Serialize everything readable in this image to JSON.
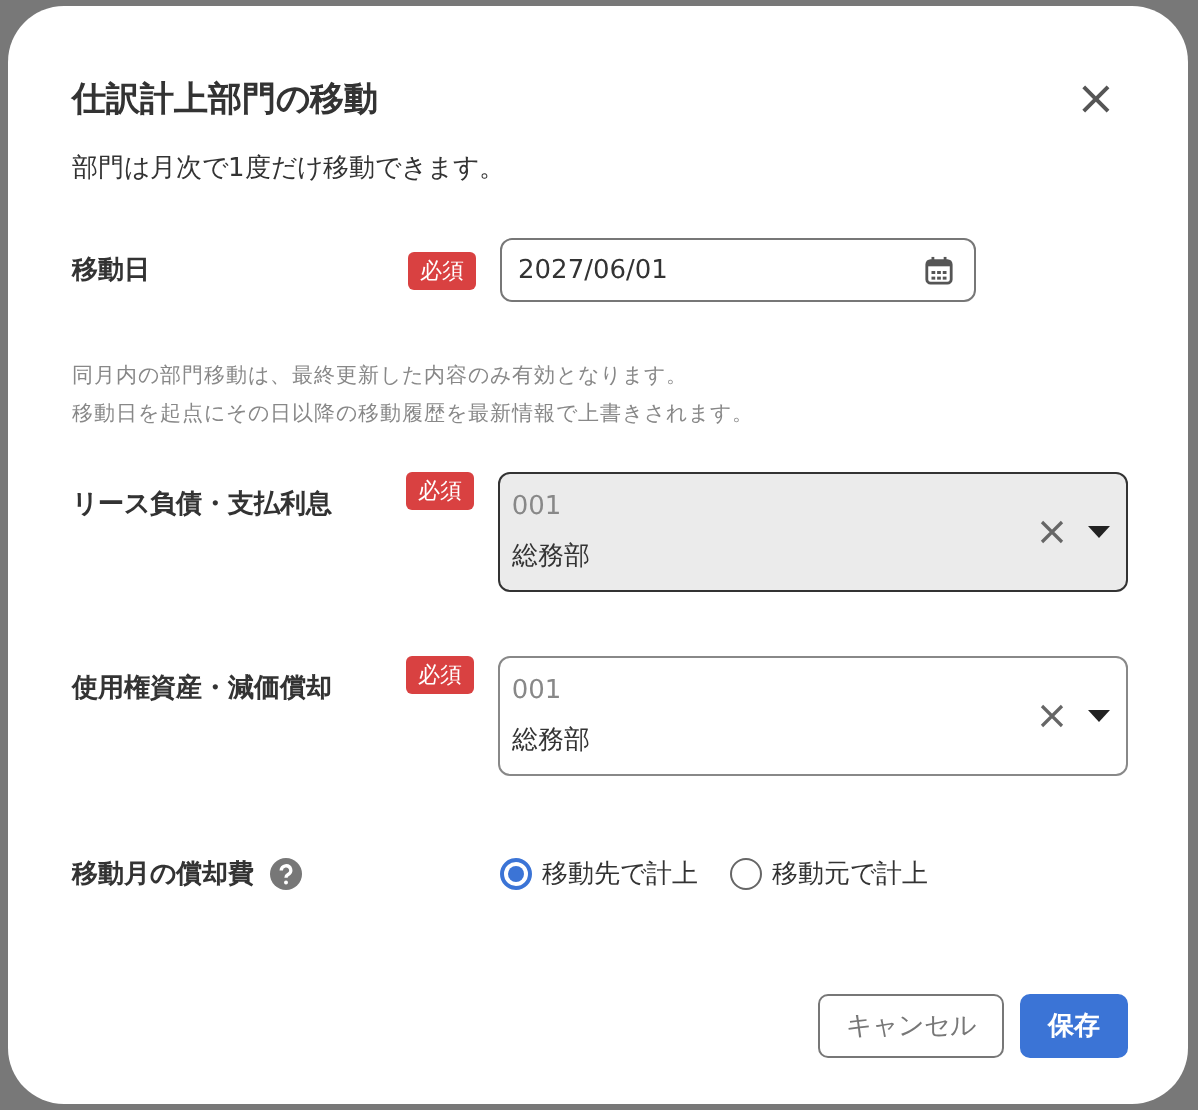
{
  "dialog": {
    "title": "仕訳計上部門の移動",
    "close": "×",
    "description": "部門は月次で1度だけ移動できます。"
  },
  "date_field": {
    "label": "移動日",
    "required": "必須",
    "value": "2027/06/01"
  },
  "notes": [
    "同月内の部門移動は、最終更新した内容のみ有効となります。",
    "移動日を起点にその日以降の移動履歴を最新情報で上書きされます。"
  ],
  "selects": [
    {
      "label": "リース負債・支払利息",
      "required": "必須",
      "code": "001",
      "value": "総務部",
      "hovered": true
    },
    {
      "label": "使用権資産・減価償却",
      "required": "必須",
      "code": "001",
      "value": "総務部",
      "hovered": false
    }
  ],
  "amortization": {
    "label": "移動月の償却費",
    "options": [
      {
        "label": "移動先で計上",
        "selected": true
      },
      {
        "label": "移動元で計上",
        "selected": false
      }
    ]
  },
  "buttons": [
    {
      "label": "キャンセル",
      "kind": "secondary"
    },
    {
      "label": "保存",
      "kind": "primary"
    }
  ]
}
